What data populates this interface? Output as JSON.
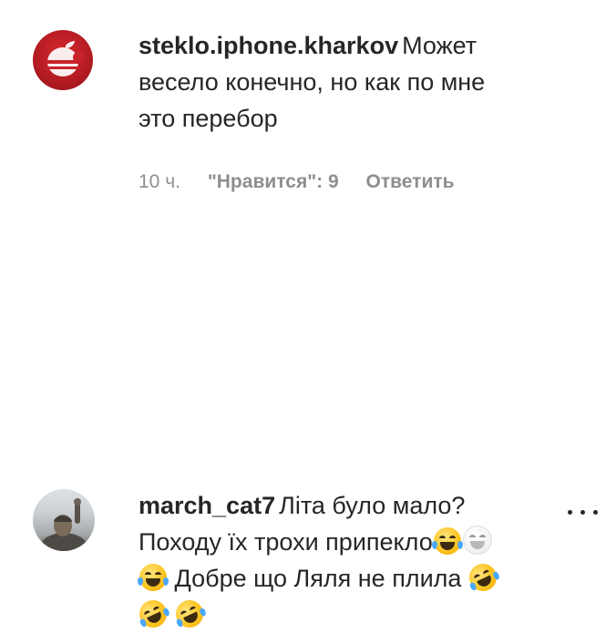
{
  "comments": [
    {
      "username": "steklo.iphone.kharkov",
      "text_lines": [
        "Может",
        "весело конечно, но как по мне",
        "это перебор"
      ],
      "time": "10 ч.",
      "likes": "\"Нравится\": 9",
      "reply": "Ответить",
      "avatar_icon": "apple-logo-avatar"
    },
    {
      "username": "march_cat7",
      "text_lines": [
        "Літа було мало?",
        "Походу їх трохи припекло",
        "Добре що Ляля не плила",
        ""
      ],
      "avatar_icon": "user-photo-avatar",
      "more_icon": "more-options-icon"
    }
  ],
  "colors": {
    "text": "#262626",
    "meta": "#8e8e8e",
    "avatar_red": "#c8232a"
  }
}
